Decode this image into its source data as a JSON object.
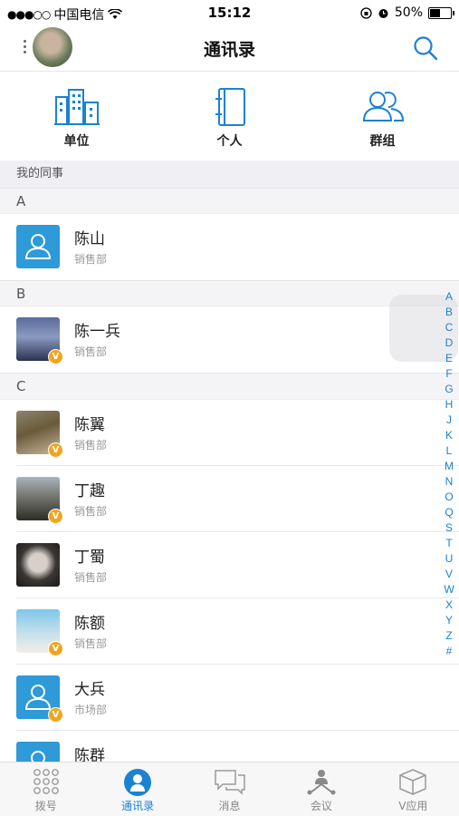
{
  "status_bar": {
    "carrier": "中国电信",
    "time": "15:12",
    "battery": "50%",
    "battery_level": 0.5
  },
  "nav": {
    "title": "通讯录"
  },
  "shortcuts": [
    {
      "label": "单位",
      "icon": "building-icon"
    },
    {
      "label": "个人",
      "icon": "contact-book-icon"
    },
    {
      "label": "群组",
      "icon": "group-icon"
    }
  ],
  "section_title": "我的同事",
  "groups": [
    {
      "letter": "A",
      "contacts": [
        {
          "name": "陈山",
          "dept": "销售部",
          "avatar": "default",
          "badge": ""
        }
      ]
    },
    {
      "letter": "B",
      "contacts": [
        {
          "name": "陈一兵",
          "dept": "销售部",
          "avatar": "photo",
          "badge": "V"
        }
      ]
    },
    {
      "letter": "C",
      "contacts": [
        {
          "name": "陈翼",
          "dept": "销售部",
          "avatar": "photo",
          "badge": "V"
        },
        {
          "name": "丁趣",
          "dept": "销售部",
          "avatar": "photo",
          "badge": "V"
        },
        {
          "name": "丁蜀",
          "dept": "销售部",
          "avatar": "photo",
          "badge": ""
        },
        {
          "name": "陈额",
          "dept": "销售部",
          "avatar": "photo",
          "badge": "V"
        },
        {
          "name": "大兵",
          "dept": "市场部",
          "avatar": "default",
          "badge": "V"
        },
        {
          "name": "陈群",
          "dept": "",
          "avatar": "default",
          "badge": ""
        }
      ]
    }
  ],
  "index_letters": [
    "A",
    "B",
    "C",
    "D",
    "E",
    "F",
    "G",
    "H",
    "J",
    "K",
    "L",
    "M",
    "N",
    "O",
    "Q",
    "S",
    "T",
    "U",
    "V",
    "W",
    "X",
    "Y",
    "Z",
    "#"
  ],
  "tabs": [
    {
      "label": "拨号",
      "icon": "dialpad-icon",
      "active": false
    },
    {
      "label": "通讯录",
      "icon": "contacts-icon",
      "active": true
    },
    {
      "label": "消息",
      "icon": "chat-icon",
      "active": false
    },
    {
      "label": "会议",
      "icon": "meeting-icon",
      "active": false
    },
    {
      "label": "V应用",
      "icon": "apps-box-icon",
      "active": false
    }
  ],
  "colors": {
    "accent": "#1a82d3",
    "avatar_default": "#2e9ad8",
    "badge": "#f1a51c"
  }
}
